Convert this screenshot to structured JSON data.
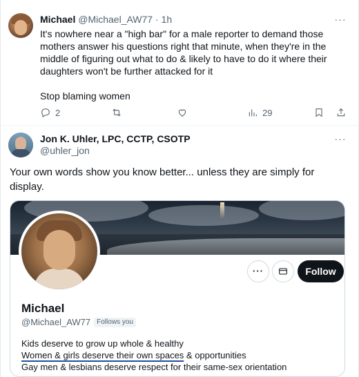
{
  "tweet1": {
    "author_name": "Michael",
    "author_handle": "@Michael_AW77",
    "separator": "·",
    "time": "1h",
    "more_label": "···",
    "text_para1": "It's nowhere near a \"high bar\" for a male reporter to demand those mothers answer his questions right that minute, when they're in the middle of figuring out what to do & likely to have to do it where their daughters won't be further attacked for it",
    "text_para2": "Stop blaming women",
    "replies": "2",
    "views": "29",
    "icons": [
      "reply-icon",
      "retweet-icon",
      "like-icon",
      "views-icon",
      "bookmark-icon",
      "share-icon"
    ]
  },
  "tweet2": {
    "author_name": "Jon K. Uhler, LPC, CCTP, CSOTP",
    "author_handle": "@uhler_jon",
    "more_label": "···",
    "text": "Your own words show you know better... unless they are simply for display."
  },
  "profile_card": {
    "name": "Michael",
    "handle": "@Michael_AW77",
    "follows_you": "Follows you",
    "follow_label": "Follow",
    "more_label": "···",
    "bio_line1": "Kids deserve to grow up whole & healthy",
    "bio_line2_highlight": "Women & girls deserve their own spaces",
    "bio_line2_rest": " & opportunities",
    "bio_line3": "Gay men & lesbians deserve respect for their same-sex orientation",
    "colors": {
      "follow_bg": "#0f1419",
      "underline": "#1d4ea0"
    }
  }
}
